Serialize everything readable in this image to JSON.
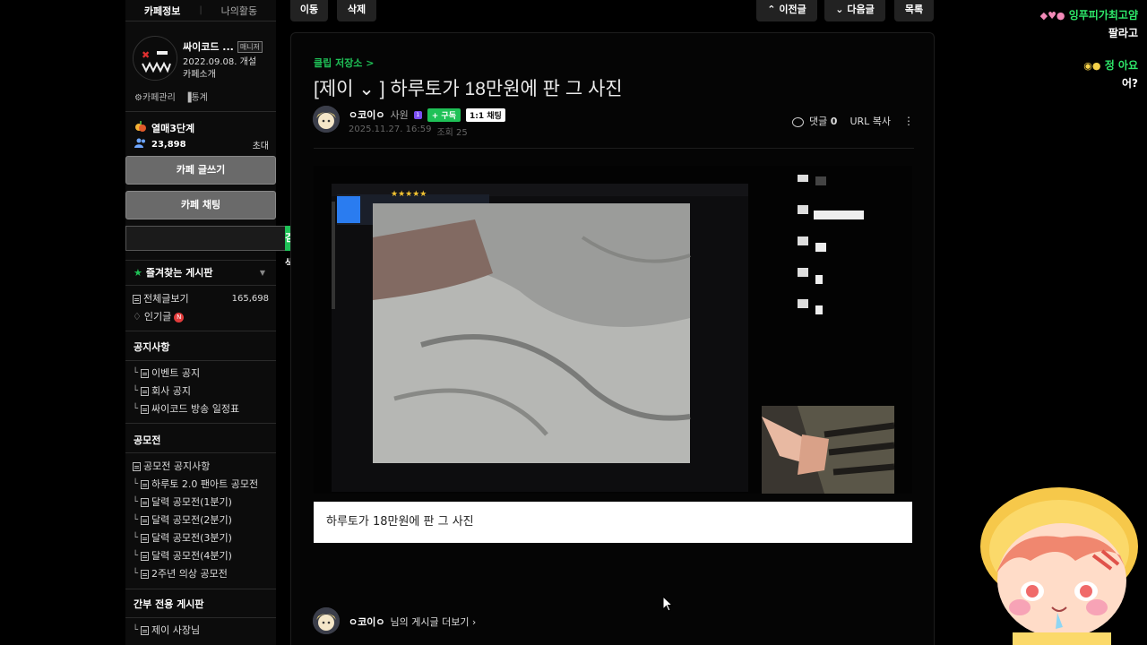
{
  "sidebar": {
    "tabs": [
      "카페정보",
      "나의활동"
    ],
    "cafe": {
      "name": "싸이코드 ...",
      "badge": "매니저",
      "opened": "2022.09.08. 개설",
      "intro": "카페소개"
    },
    "links": [
      "카페관리",
      "통계"
    ],
    "level": "열매3단계",
    "members": "23,898",
    "invite": "초대",
    "write_button": "카페 글쓰기",
    "chat_button": "카페 채팅",
    "search_button": "검색",
    "search_placeholder": "",
    "favorites": {
      "title": "즐겨찾는 게시판",
      "items": [
        {
          "label": "전체글보기",
          "count": "165,698"
        },
        {
          "label": "인기글",
          "badge": "N"
        }
      ]
    },
    "notice": {
      "title": "공지사항",
      "items": [
        "이벤트 공지",
        "회사 공지",
        "싸이코드 방송 일정표"
      ]
    },
    "contest": {
      "title": "공모전",
      "items": [
        "공모전 공지사항",
        "하루토 2.0 팬아트 공모전",
        "달력 공모전(1분기)",
        "달력 공모전(2분기)",
        "달력 공모전(3분기)",
        "달력 공모전(4분기)",
        "2주년 의상 공모전"
      ]
    },
    "staff": {
      "title": "간부 전용 게시판",
      "items": [
        "제이 사장님"
      ]
    }
  },
  "topbar": {
    "move": "이동",
    "delete": "삭제",
    "prev": "이전글",
    "next": "다음글",
    "list": "목록"
  },
  "article": {
    "board_link": "클립 저장소 >",
    "title": "[제이 ⌄ ] 하루토가 18만원에 판 그 사진",
    "author": "ㅇ코이ㅇ",
    "rank": "사원",
    "subscribe": "+ 구독",
    "chat": "1:1 채팅",
    "date": "2025.11.27. 16:59",
    "views": "조회 25",
    "comments_label": "댓글",
    "comments_count": "0",
    "url_copy": "URL 복사",
    "caption": "하루토가 18만원에 판 그 사진",
    "footer_author": "ㅇ코이ㅇ",
    "footer_more": "님의 게시글 더보기 ›"
  },
  "overlay_chat": [
    {
      "user": "잉푸피가최고얌",
      "message": "팔라고"
    },
    {
      "user": "정 아요",
      "message": "어?"
    }
  ],
  "colors": {
    "accent_green": "#1fc157",
    "background": "#000000",
    "panel": "#0c0c0c"
  }
}
